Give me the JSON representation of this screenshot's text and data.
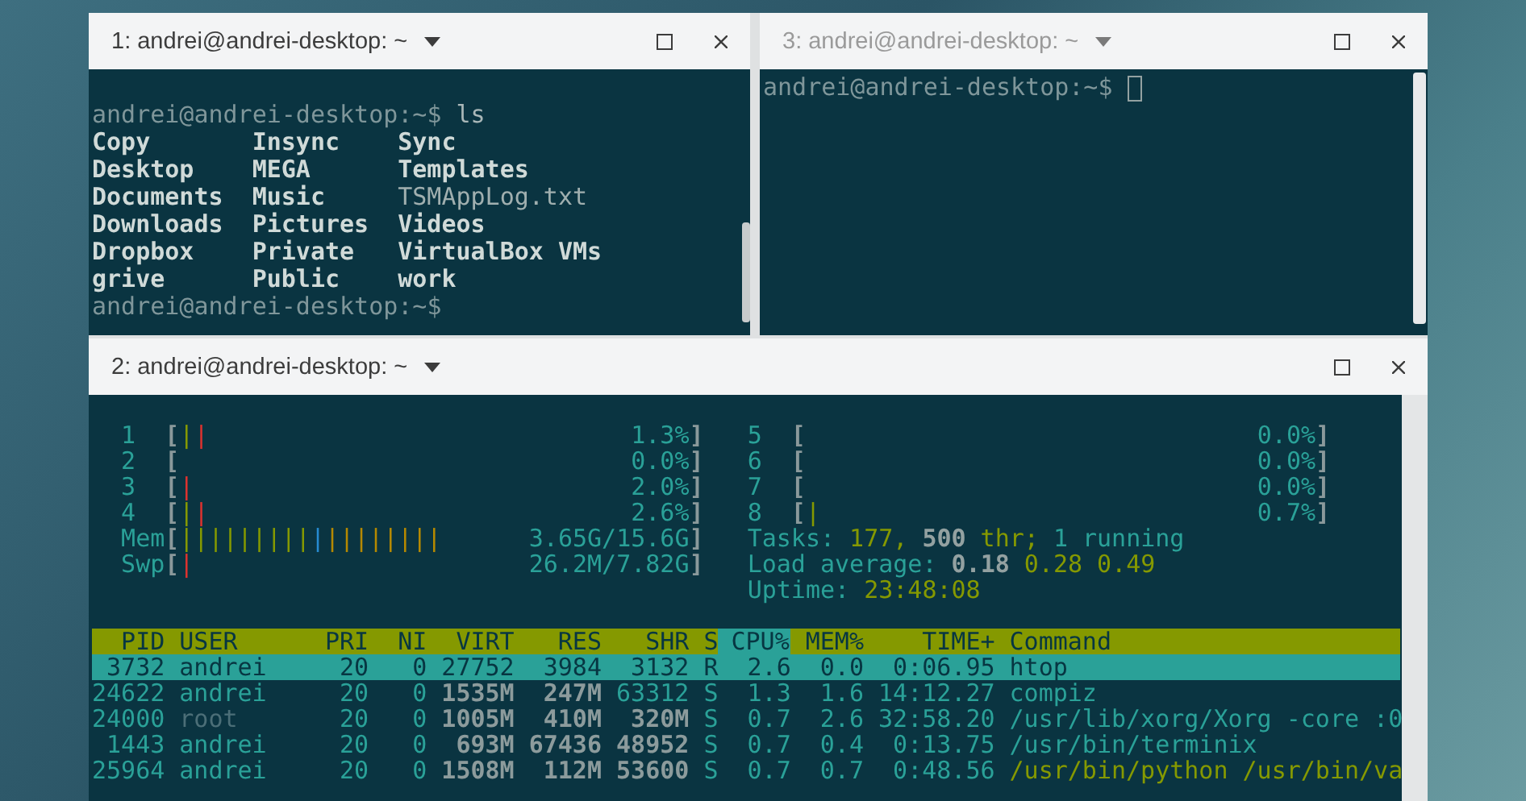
{
  "top_panes": [
    {
      "title": "1: andrei@andrei-desktop: ~",
      "active": true,
      "prompt": "andrei@andrei-desktop:~$",
      "command": "ls",
      "listing": [
        {
          "name": "Copy",
          "kind": "dir"
        },
        {
          "name": "Insync",
          "kind": "dir"
        },
        {
          "name": "Sync",
          "kind": "dir"
        },
        {
          "name": "Desktop",
          "kind": "dir"
        },
        {
          "name": "MEGA",
          "kind": "dir"
        },
        {
          "name": "Templates",
          "kind": "dir"
        },
        {
          "name": "Documents",
          "kind": "dir"
        },
        {
          "name": "Music",
          "kind": "dir"
        },
        {
          "name": "TSMAppLog.txt",
          "kind": "file"
        },
        {
          "name": "Downloads",
          "kind": "dir"
        },
        {
          "name": "Pictures",
          "kind": "dir"
        },
        {
          "name": "Videos",
          "kind": "dir"
        },
        {
          "name": "Dropbox",
          "kind": "dir"
        },
        {
          "name": "Private",
          "kind": "dir"
        },
        {
          "name": "VirtualBox VMs",
          "kind": "dir"
        },
        {
          "name": "grive",
          "kind": "dir"
        },
        {
          "name": "Public",
          "kind": "dir"
        },
        {
          "name": "work",
          "kind": "dir"
        }
      ],
      "end_prompt": "andrei@andrei-desktop:~$"
    },
    {
      "title": "3: andrei@andrei-desktop: ~",
      "active": false,
      "prompt": "andrei@andrei-desktop:~$"
    }
  ],
  "bottom_pane": {
    "title": "2: andrei@andrei-desktop: ~",
    "active": true,
    "htop": {
      "left_meters": [
        {
          "label": "1",
          "open": "[",
          "segments": [
            {
              "text": "|",
              "color": "#859900"
            },
            {
              "text": "|",
              "color": "#dc322f"
            }
          ],
          "value": "1.3%",
          "close": "]"
        },
        {
          "label": "2",
          "open": "[",
          "value": "0.0%",
          "close": "]"
        },
        {
          "label": "3",
          "open": "[",
          "segments": [
            {
              "text": "|",
              "color": "#dc322f"
            }
          ],
          "value": "2.0%",
          "close": "]"
        },
        {
          "label": "4",
          "open": "[",
          "segments": [
            {
              "text": "|",
              "color": "#859900"
            },
            {
              "text": "|",
              "color": "#dc322f"
            }
          ],
          "value": "2.6%",
          "close": "]"
        },
        {
          "label": "Mem",
          "open": "[",
          "segments": [
            {
              "text": "|||||||||",
              "color": "#859900"
            },
            {
              "text": "|",
              "color": "#268bd2"
            },
            {
              "text": "||||||||",
              "color": "#b58900"
            }
          ],
          "value": "3.65G/15.6G",
          "close": "]"
        },
        {
          "label": "Swp",
          "open": "[",
          "segments": [
            {
              "text": "|",
              "color": "#dc322f"
            }
          ],
          "value": "26.2M/7.82G",
          "close": "]"
        }
      ],
      "right_meters": [
        {
          "label": "5",
          "open": "[",
          "value": "0.0%",
          "close": "]"
        },
        {
          "label": "6",
          "open": "[",
          "value": "0.0%",
          "close": "]"
        },
        {
          "label": "7",
          "open": "[",
          "value": "0.0%",
          "close": "]"
        },
        {
          "label": "8",
          "open": "[",
          "segments": [
            {
              "text": "|",
              "color": "#859900"
            }
          ],
          "value": "0.7%",
          "close": "]"
        }
      ],
      "summary": [
        [
          {
            "text": "Tasks:",
            "kind": "label"
          },
          {
            "text": "177,",
            "kind": "value"
          },
          {
            "text": "500",
            "kind": "bold"
          },
          {
            "text": "thr;",
            "kind": "value"
          },
          {
            "text": "1 running",
            "kind": "label"
          }
        ],
        [
          {
            "text": "Load average:",
            "kind": "label"
          },
          {
            "text": "0.18",
            "kind": "bold"
          },
          {
            "text": "0.28",
            "kind": "value"
          },
          {
            "text": "0.49",
            "kind": "value"
          }
        ],
        [
          {
            "text": "Uptime:",
            "kind": "label"
          },
          {
            "text": "23:48:08",
            "kind": "value"
          }
        ]
      ],
      "table": {
        "columns": [
          {
            "label": "PID",
            "sorted": false
          },
          {
            "label": "USER",
            "sorted": false
          },
          {
            "label": "PRI",
            "sorted": false
          },
          {
            "label": "NI",
            "sorted": false
          },
          {
            "label": "VIRT",
            "sorted": false
          },
          {
            "label": "RES",
            "sorted": false
          },
          {
            "label": "SHR",
            "sorted": false
          },
          {
            "label": "S",
            "sorted": false
          },
          {
            "label": "CPU%",
            "sorted": true
          },
          {
            "label": "MEM%",
            "sorted": false
          },
          {
            "label": "TIME+",
            "sorted": false
          },
          {
            "label": "Command",
            "sorted": false
          }
        ],
        "rows": [
          {
            "selected": true,
            "cells": [
              "3732",
              "andrei",
              "20",
              "0",
              "27752",
              "3984",
              "3132",
              "R",
              "2.6",
              "0.0",
              "0:06.95",
              "htop"
            ]
          },
          {
            "selected": false,
            "cells": [
              "24622",
              "andrei",
              "20",
              "0",
              {
                "text": "1535M",
                "kind": "large"
              },
              {
                "text": "247M",
                "kind": "large"
              },
              "63312",
              "S",
              "1.3",
              "1.6",
              "14:12.27",
              "compiz"
            ]
          },
          {
            "selected": false,
            "cells": [
              "24000",
              {
                "text": "root",
                "kind": "dim"
              },
              "20",
              "0",
              {
                "text": "1005M",
                "kind": "large"
              },
              {
                "text": "410M",
                "kind": "large"
              },
              {
                "text": "320M",
                "kind": "large"
              },
              "S",
              "0.7",
              "2.6",
              "32:58.20",
              "/usr/lib/xorg/Xorg -core :0"
            ]
          },
          {
            "selected": false,
            "cells": [
              "1443",
              "andrei",
              "20",
              "0",
              {
                "text": "693M",
                "kind": "large"
              },
              {
                "text": "67436",
                "kind": "large"
              },
              {
                "text": "48952",
                "kind": "large"
              },
              "S",
              "0.7",
              "0.4",
              "0:13.75",
              "/usr/bin/terminix"
            ]
          },
          {
            "selected": false,
            "cells": [
              "25964",
              "andrei",
              "20",
              "0",
              {
                "text": "1508M",
                "kind": "large"
              },
              {
                "text": "112M",
                "kind": "large"
              },
              {
                "text": "53600",
                "kind": "large"
              },
              "S",
              "0.7",
              "0.7",
              "0:48.56",
              {
                "text": "/usr/bin/python /usr/bin/va",
                "kind": "thread"
              }
            ]
          }
        ]
      }
    }
  }
}
